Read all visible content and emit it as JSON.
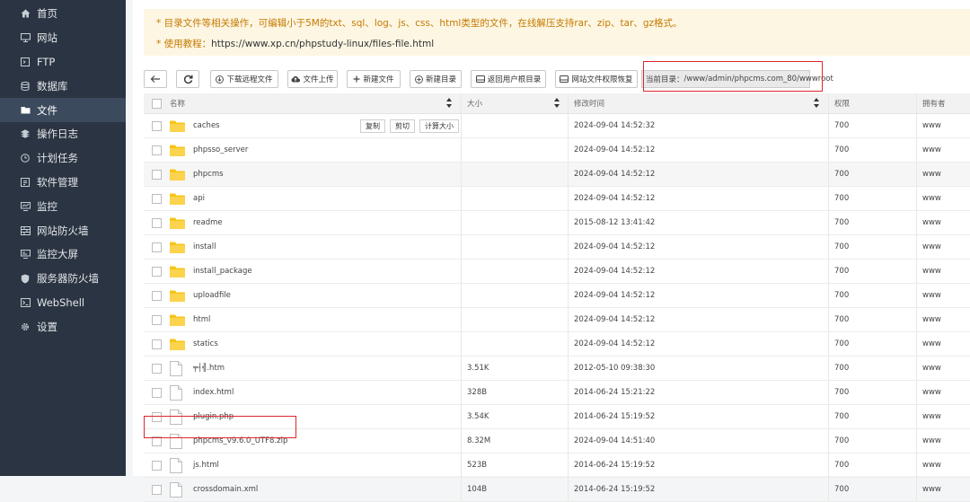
{
  "sidebar": {
    "items": [
      {
        "label": "首页",
        "icon": "home-icon",
        "active": false
      },
      {
        "label": "网站",
        "icon": "monitor-icon",
        "active": false
      },
      {
        "label": "FTP",
        "icon": "ftp-icon",
        "active": false
      },
      {
        "label": "数据库",
        "icon": "database-icon",
        "active": false
      },
      {
        "label": "文件",
        "icon": "folder-icon",
        "active": true
      },
      {
        "label": "操作日志",
        "icon": "log-icon",
        "active": false
      },
      {
        "label": "计划任务",
        "icon": "clock-icon",
        "active": false
      },
      {
        "label": "软件管理",
        "icon": "software-icon",
        "active": false
      },
      {
        "label": "监控",
        "icon": "monitor-chart-icon",
        "active": false
      },
      {
        "label": "网站防火墙",
        "icon": "firewall-icon",
        "active": false
      },
      {
        "label": "监控大屏",
        "icon": "screen-icon",
        "active": false
      },
      {
        "label": "服务器防火墙",
        "icon": "shield-icon",
        "active": false
      },
      {
        "label": "WebShell",
        "icon": "terminal-icon",
        "active": false
      },
      {
        "label": "设置",
        "icon": "gear-icon",
        "active": false
      }
    ]
  },
  "notice": {
    "line1": "* 目录文件等相关操作，可编辑小于5M的txt、sql、log、js、css、html类型的文件，在线解压支持rar、zip、tar、gz格式。",
    "line2_prefix": "* 使用教程：",
    "line2_link": "https://www.xp.cn/phpstudy-linux/files-file.html"
  },
  "toolbar": {
    "download": "下载远程文件",
    "upload": "文件上传",
    "new_file": "新建文件",
    "new_dir": "新建目录",
    "back_root": "返回用户根目录",
    "restore_perm": "网站文件权限恢复",
    "path_label": "当前目录：",
    "path_value": "/www/admin/phpcms.com_80/wwwroot"
  },
  "table": {
    "headers": {
      "name": "名称",
      "size": "大小",
      "mtime": "修改时间",
      "perm": "权限",
      "owner": "拥有者"
    },
    "row_actions": {
      "copy": "复制",
      "cut": "剪切",
      "calc": "计算大小"
    },
    "rows": [
      {
        "name": "caches",
        "type": "folder",
        "size": "",
        "mtime": "2024-09-04 14:52:32",
        "perm": "700",
        "owner": "www"
      },
      {
        "name": "phpsso_server",
        "type": "folder",
        "size": "",
        "mtime": "2024-09-04 14:52:12",
        "perm": "700",
        "owner": "www"
      },
      {
        "name": "phpcms",
        "type": "folder",
        "size": "",
        "mtime": "2024-09-04 14:52:12",
        "perm": "700",
        "owner": "www"
      },
      {
        "name": "api",
        "type": "folder",
        "size": "",
        "mtime": "2024-09-04 14:52:12",
        "perm": "700",
        "owner": "www"
      },
      {
        "name": "readme",
        "type": "folder",
        "size": "",
        "mtime": "2015-08-12 13:41:42",
        "perm": "700",
        "owner": "www"
      },
      {
        "name": "install",
        "type": "folder",
        "size": "",
        "mtime": "2024-09-04 14:52:12",
        "perm": "700",
        "owner": "www"
      },
      {
        "name": "install_package",
        "type": "folder",
        "size": "",
        "mtime": "2024-09-04 14:52:12",
        "perm": "700",
        "owner": "www"
      },
      {
        "name": "uploadfile",
        "type": "folder",
        "size": "",
        "mtime": "2024-09-04 14:52:12",
        "perm": "700",
        "owner": "www"
      },
      {
        "name": "html",
        "type": "folder",
        "size": "",
        "mtime": "2024-09-04 14:52:12",
        "perm": "700",
        "owner": "www"
      },
      {
        "name": "statics",
        "type": "folder",
        "size": "",
        "mtime": "2024-09-04 14:52:12",
        "perm": "700",
        "owner": "www"
      },
      {
        "name": "╤┤╣.htm",
        "type": "file",
        "size": "3.51K",
        "mtime": "2012-05-10 09:38:30",
        "perm": "700",
        "owner": "www"
      },
      {
        "name": "index.html",
        "type": "file",
        "size": "328B",
        "mtime": "2014-06-24 15:21:22",
        "perm": "700",
        "owner": "www"
      },
      {
        "name": "plugin.php",
        "type": "file",
        "size": "3.54K",
        "mtime": "2014-06-24 15:19:52",
        "perm": "700",
        "owner": "www"
      },
      {
        "name": "phpcms_v9.6.0_UTF8.zip",
        "type": "file",
        "size": "8.32M",
        "mtime": "2024-09-04 14:51:40",
        "perm": "700",
        "owner": "www"
      },
      {
        "name": "js.html",
        "type": "file",
        "size": "523B",
        "mtime": "2014-06-24 15:19:52",
        "perm": "700",
        "owner": "www"
      },
      {
        "name": "crossdomain.xml",
        "type": "file",
        "size": "104B",
        "mtime": "2014-06-24 15:19:52",
        "perm": "700",
        "owner": "www"
      }
    ]
  }
}
